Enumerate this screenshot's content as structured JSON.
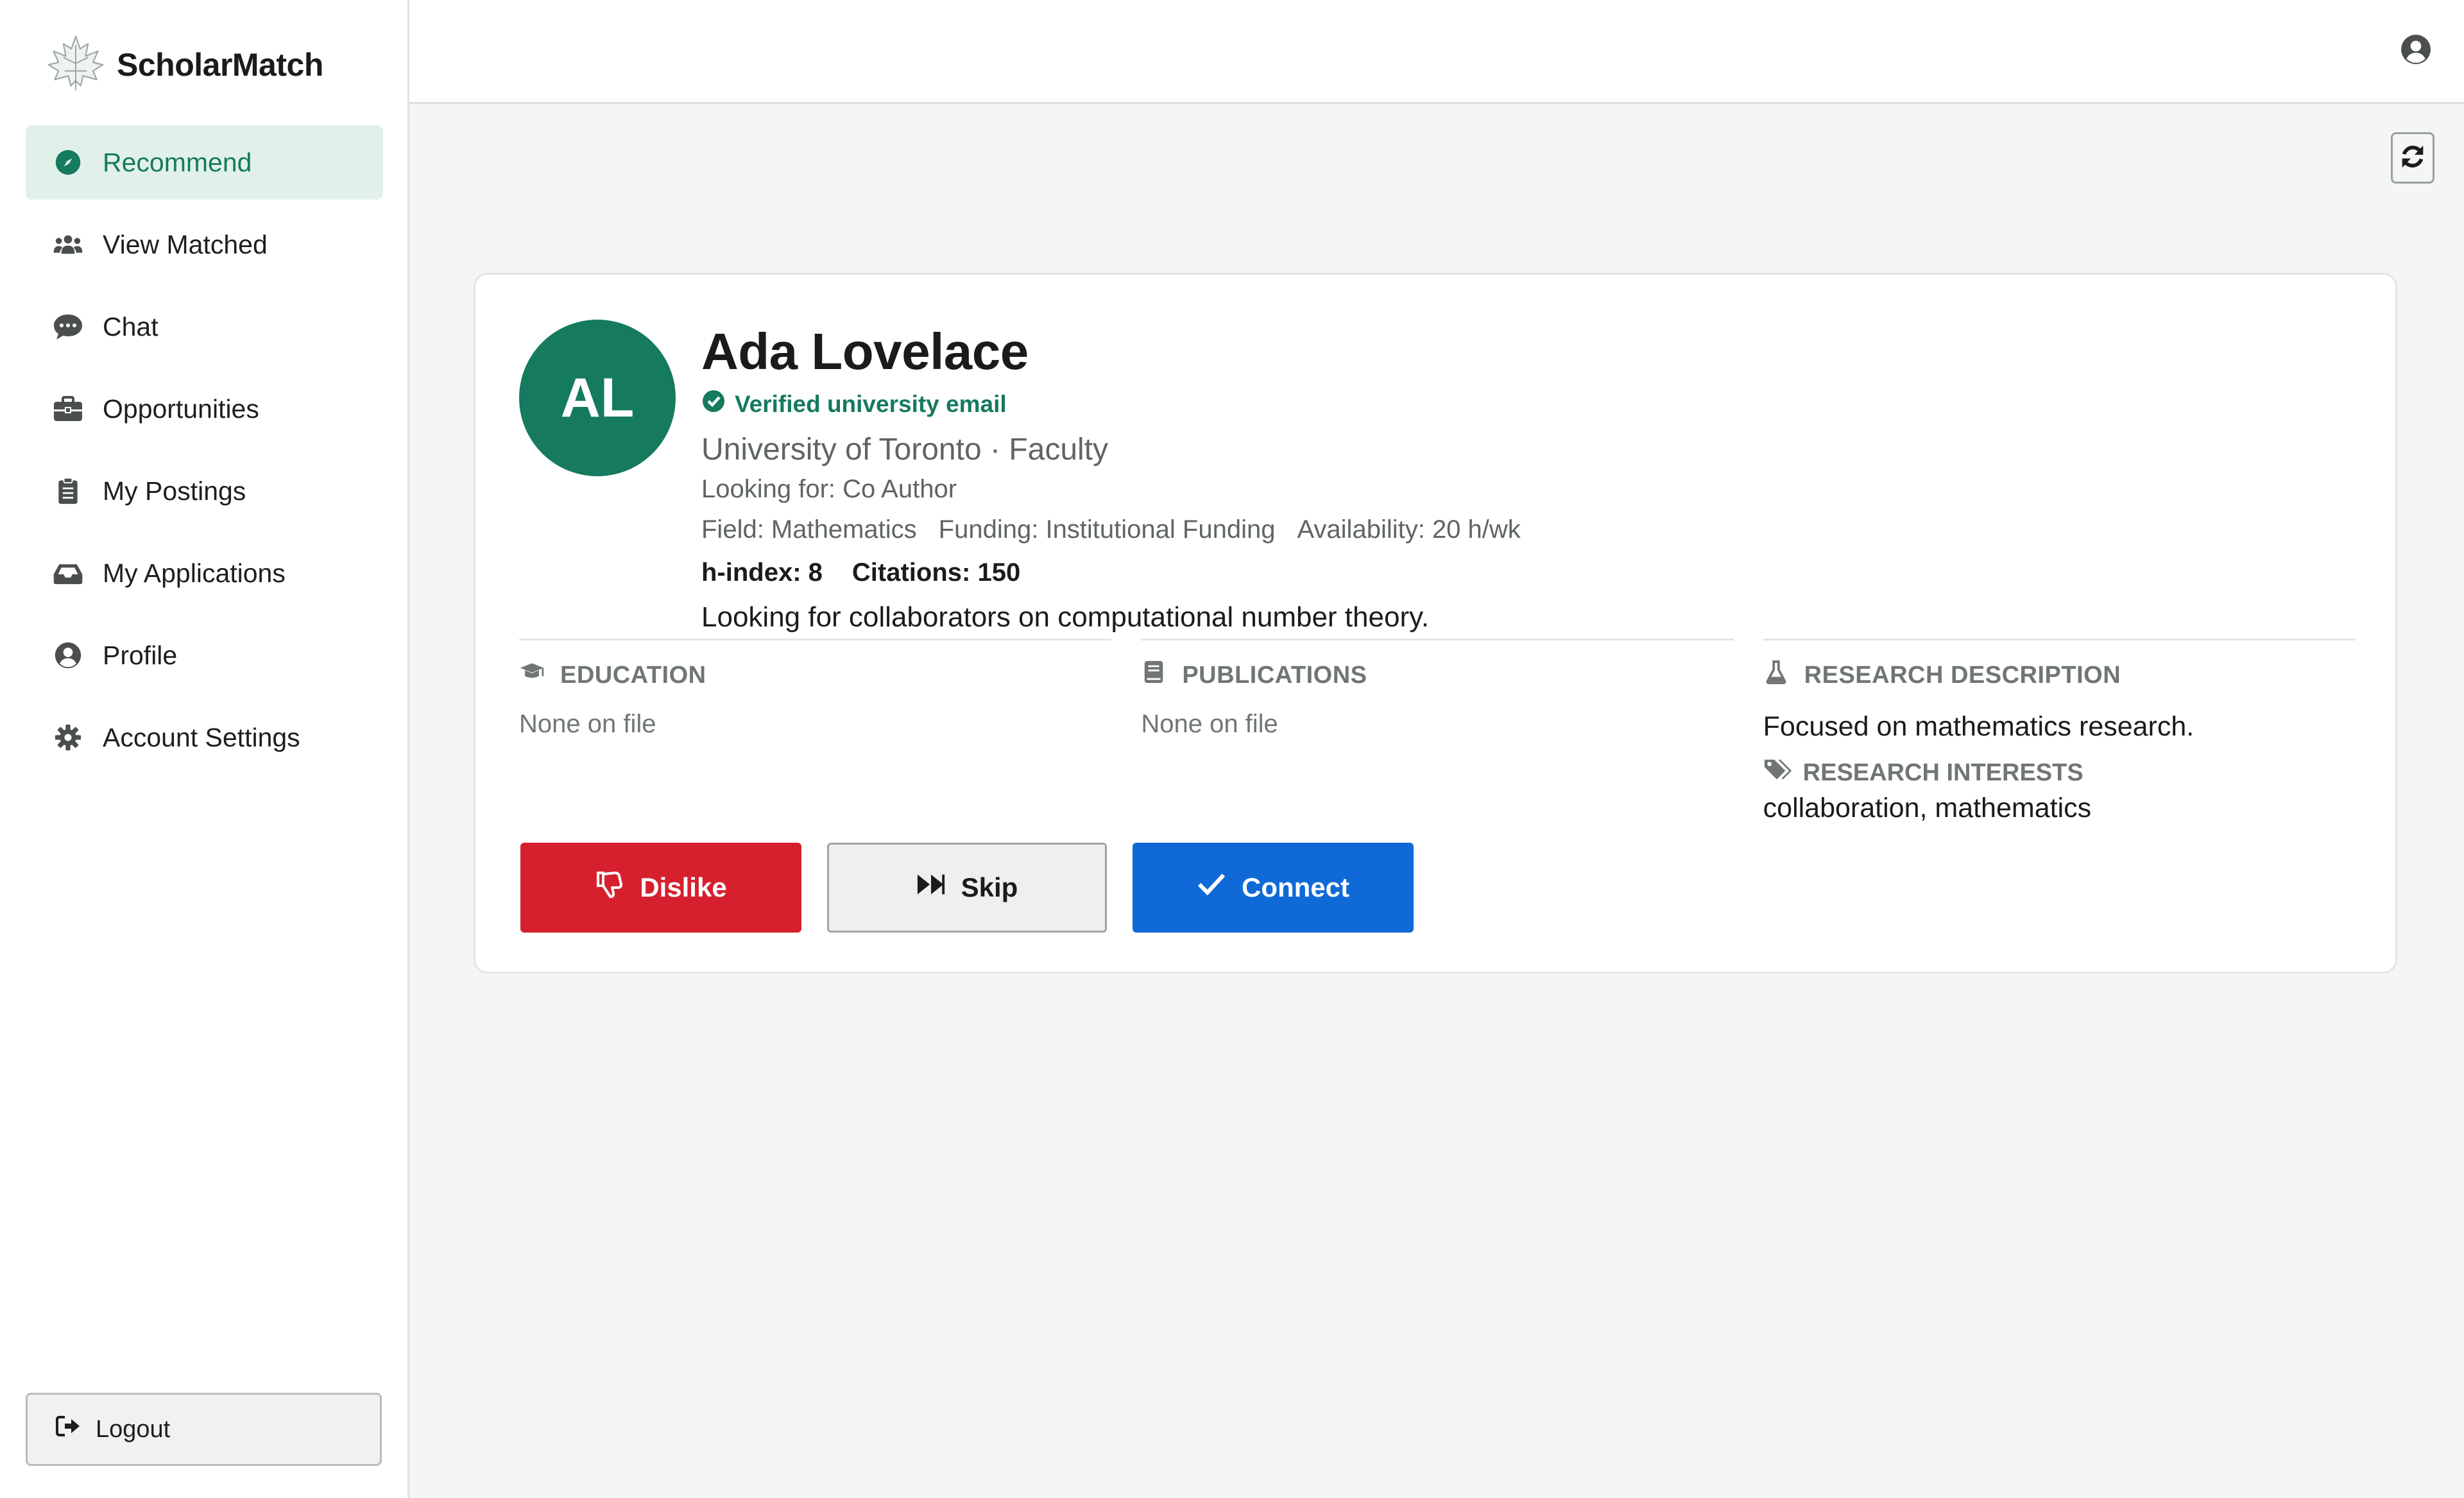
{
  "brand": {
    "name": "ScholarMatch"
  },
  "colors": {
    "accent": "#157a5e",
    "danger": "#d7202e",
    "primary": "#0f6ad7"
  },
  "sidebar": {
    "items": [
      {
        "label": "Recommend",
        "icon": "compass-icon",
        "active": true
      },
      {
        "label": "View Matched",
        "icon": "users-icon"
      },
      {
        "label": "Chat",
        "icon": "chat-icon"
      },
      {
        "label": "Opportunities",
        "icon": "briefcase-icon"
      },
      {
        "label": "My Postings",
        "icon": "clipboard-icon"
      },
      {
        "label": "My Applications",
        "icon": "inbox-icon"
      },
      {
        "label": "Profile",
        "icon": "user-circle-icon"
      },
      {
        "label": "Account Settings",
        "icon": "gear-icon"
      }
    ],
    "logout": "Logout"
  },
  "profile": {
    "initials": "AL",
    "name": "Ada Lovelace",
    "verified": "Verified university email",
    "affiliation": "University of Toronto · Faculty",
    "looking_for": "Looking for: Co Author",
    "field": "Field: Mathematics",
    "funding": "Funding: Institutional Funding",
    "availability": "Availability: 20 h/wk",
    "h_index": "h-index: 8",
    "citations": "Citations: 150",
    "bio": "Looking for collaborators on computational number theory."
  },
  "sections": {
    "education": {
      "title": "EDUCATION",
      "value": "None on file"
    },
    "publications": {
      "title": "PUBLICATIONS",
      "value": "None on file"
    },
    "research": {
      "title": "RESEARCH DESCRIPTION",
      "value": "Focused on mathematics research.",
      "interests_title": "RESEARCH INTERESTS",
      "interests": "collaboration, mathematics"
    }
  },
  "actions": {
    "dislike": "Dislike",
    "skip": "Skip",
    "connect": "Connect"
  }
}
